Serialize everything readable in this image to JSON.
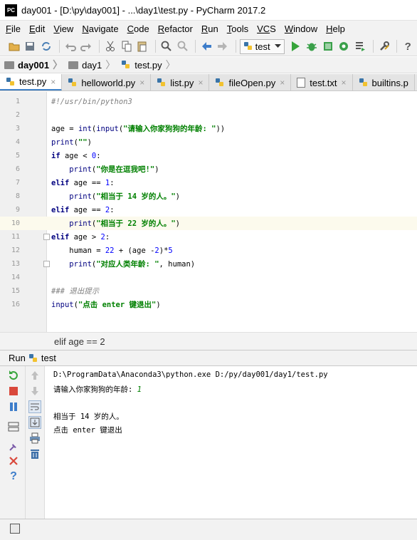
{
  "window": {
    "icon_text": "PC",
    "title": "day001 - [D:\\py\\day001] - ...\\day1\\test.py - PyCharm 2017.2"
  },
  "menu": [
    {
      "first": "F",
      "rest": "ile"
    },
    {
      "first": "E",
      "rest": "dit"
    },
    {
      "first": "V",
      "rest": "iew"
    },
    {
      "first": "N",
      "rest": "avigate"
    },
    {
      "first": "C",
      "rest": "ode"
    },
    {
      "first": "R",
      "rest": "efactor"
    },
    {
      "first": "R",
      "rest": "un"
    },
    {
      "first": "T",
      "rest": "ools"
    },
    {
      "first": "VC",
      "rest": "S"
    },
    {
      "first": "W",
      "rest": "indow"
    },
    {
      "first": "H",
      "rest": "elp"
    }
  ],
  "toolbar": {
    "run_config": "test",
    "help": "?"
  },
  "breadcrumb": [
    "day001",
    "day1",
    "test.py"
  ],
  "tabs": [
    {
      "label": "test.py",
      "close": "×",
      "icon": "python-file-icon"
    },
    {
      "label": "helloworld.py",
      "close": "×",
      "icon": "python-file-icon"
    },
    {
      "label": "list.py",
      "close": "×",
      "icon": "python-file-icon"
    },
    {
      "label": "fileOpen.py",
      "close": "×",
      "icon": "python-file-icon"
    },
    {
      "label": "test.txt",
      "close": "×",
      "icon": "text-file-icon"
    },
    {
      "label": "builtins.p",
      "close": "",
      "icon": "python-file-icon"
    }
  ],
  "editor": {
    "line_numbers": [
      "1",
      "2",
      "3",
      "4",
      "5",
      "6",
      "7",
      "8",
      "9",
      "10",
      "11",
      "12",
      "13",
      "14",
      "15",
      "16"
    ],
    "current_line": 10,
    "lines": [
      [
        {
          "t": "#!/usr/bin/python3",
          "c": "com"
        }
      ],
      [],
      [
        {
          "t": "age = "
        },
        {
          "t": "int",
          "c": "bi"
        },
        {
          "t": "("
        },
        {
          "t": "input",
          "c": "bi"
        },
        {
          "t": "("
        },
        {
          "t": "\"请输入你家狗狗的年龄: \"",
          "c": "str"
        },
        {
          "t": "))"
        }
      ],
      [
        {
          "t": "print",
          "c": "bi"
        },
        {
          "t": "("
        },
        {
          "t": "\"\"",
          "c": "str"
        },
        {
          "t": ")"
        }
      ],
      [
        {
          "t": "if ",
          "c": "kw"
        },
        {
          "t": "age < "
        },
        {
          "t": "0",
          "c": "num"
        },
        {
          "t": ":"
        }
      ],
      [
        {
          "t": "    "
        },
        {
          "t": "print",
          "c": "bi"
        },
        {
          "t": "("
        },
        {
          "t": "\"你是在逗我吧!\"",
          "c": "str"
        },
        {
          "t": ")"
        }
      ],
      [
        {
          "t": "elif ",
          "c": "kw"
        },
        {
          "t": "age == "
        },
        {
          "t": "1",
          "c": "num"
        },
        {
          "t": ":"
        }
      ],
      [
        {
          "t": "    "
        },
        {
          "t": "print",
          "c": "bi"
        },
        {
          "t": "("
        },
        {
          "t": "\"相当于 14 岁的人。\"",
          "c": "str"
        },
        {
          "t": ")"
        }
      ],
      [
        {
          "t": "elif ",
          "c": "kw"
        },
        {
          "t": "age == "
        },
        {
          "t": "2",
          "c": "num"
        },
        {
          "t": ":"
        }
      ],
      [
        {
          "t": "    "
        },
        {
          "t": "print",
          "c": "bi"
        },
        {
          "t": "("
        },
        {
          "t": "\"相当于 22 岁的人。\"",
          "c": "str"
        },
        {
          "t": ")"
        }
      ],
      [
        {
          "t": "elif ",
          "c": "kw"
        },
        {
          "t": "age > "
        },
        {
          "t": "2",
          "c": "num"
        },
        {
          "t": ":"
        }
      ],
      [
        {
          "t": "    human = "
        },
        {
          "t": "22",
          "c": "num"
        },
        {
          "t": " + (age -"
        },
        {
          "t": "2",
          "c": "num"
        },
        {
          "t": ")*"
        },
        {
          "t": "5",
          "c": "num"
        }
      ],
      [
        {
          "t": "    "
        },
        {
          "t": "print",
          "c": "bi"
        },
        {
          "t": "("
        },
        {
          "t": "\"对应人类年龄: \"",
          "c": "str"
        },
        {
          "t": ", human)"
        }
      ],
      [],
      [
        {
          "t": "### 退出提示",
          "c": "com"
        }
      ],
      [
        {
          "t": "input",
          "c": "bi"
        },
        {
          "t": "("
        },
        {
          "t": "\"点击 enter 键退出\"",
          "c": "str"
        },
        {
          "t": ")"
        }
      ]
    ],
    "status_text": "elif age == 2"
  },
  "run_panel": {
    "label": "Run",
    "config_name": "test",
    "console": [
      {
        "text": "D:\\ProgramData\\Anaconda3\\python.exe D:/py/day001/day1/test.py",
        "kind": "cmd"
      },
      {
        "text": "请输入你家狗狗的年龄: ",
        "input": "1",
        "kind": "prompt"
      },
      {
        "text": "",
        "kind": "blank"
      },
      {
        "text": "相当于 14 岁的人。",
        "kind": "out"
      },
      {
        "text": "点击 enter 键退出",
        "kind": "out"
      }
    ]
  },
  "colors": {
    "keyword": "#000080",
    "string": "#008000",
    "number": "#0000ff",
    "comment": "#808080",
    "active_tab_underline": "#4083c9",
    "current_line": "#fcfaed"
  }
}
